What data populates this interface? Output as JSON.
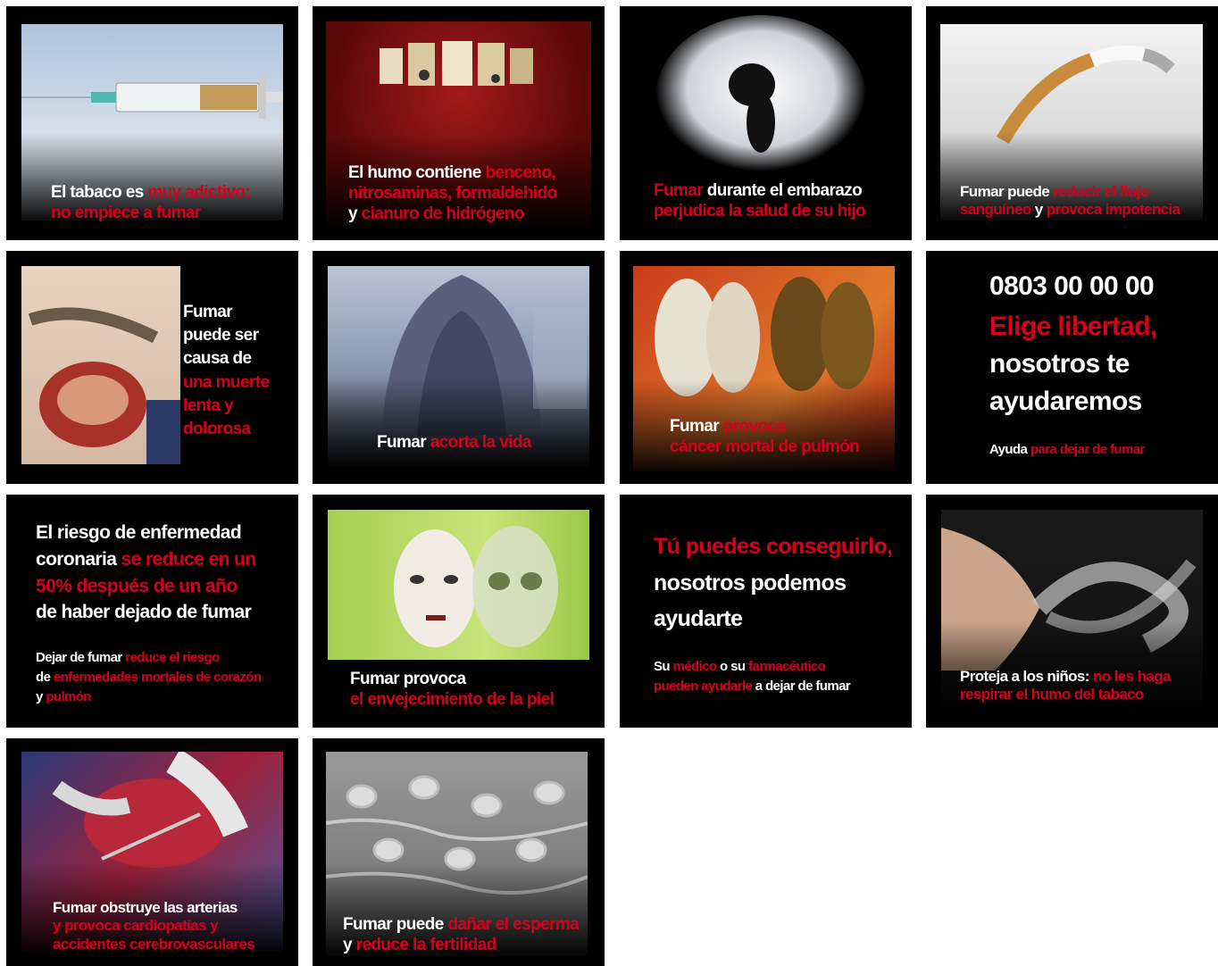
{
  "cards": [
    {
      "parts": [
        [
          "El tabaco es ",
          ""
        ],
        [
          "muy adictivo:",
          "red"
        ],
        [
          "\n",
          ""
        ],
        [
          "no empiece a fumar",
          "red"
        ]
      ]
    },
    {
      "parts": [
        [
          "El humo contiene ",
          ""
        ],
        [
          "benceno,",
          "red"
        ],
        [
          "\n",
          ""
        ],
        [
          "nitrosaminas, formaldehido",
          "red"
        ],
        [
          "\n",
          ""
        ],
        [
          "y ",
          ""
        ],
        [
          "cianuro de hidrógeno",
          "red"
        ]
      ]
    },
    {
      "parts": [
        [
          "Fumar",
          "red"
        ],
        [
          " durante el embarazo",
          ""
        ],
        [
          "\n",
          ""
        ],
        [
          "perjudica la salud de su hijo",
          "red"
        ]
      ]
    },
    {
      "parts": [
        [
          "Fumar puede ",
          ""
        ],
        [
          "reducir el flujo",
          "red"
        ],
        [
          "\n",
          ""
        ],
        [
          "sanguíneo",
          "red"
        ],
        [
          " y ",
          ""
        ],
        [
          "provoca impotencia",
          "red"
        ]
      ]
    },
    {
      "parts": [
        [
          "Fumar",
          ""
        ],
        [
          "\n",
          ""
        ],
        [
          "puede ser",
          ""
        ],
        [
          "\n",
          ""
        ],
        [
          "causa de",
          ""
        ],
        [
          "\n",
          ""
        ],
        [
          "una muerte",
          "red"
        ],
        [
          "\n",
          ""
        ],
        [
          "lenta y",
          "red"
        ],
        [
          "\n",
          ""
        ],
        [
          "dolorosa",
          "red"
        ]
      ]
    },
    {
      "parts": [
        [
          "Fumar ",
          ""
        ],
        [
          "acorta la vida",
          "red"
        ]
      ]
    },
    {
      "parts": [
        [
          "Fumar ",
          ""
        ],
        [
          "provoca",
          "red"
        ],
        [
          "\n",
          ""
        ],
        [
          "cáncer mortal de pulmón",
          "red"
        ]
      ]
    },
    {
      "parts": [
        [
          "0803 00 00 00",
          ""
        ]
      ],
      "slogan": [
        [
          "Elige libertad,",
          "red"
        ],
        [
          "\n",
          ""
        ],
        [
          "nosotros te",
          ""
        ],
        [
          "\n",
          ""
        ],
        [
          "ayudaremos",
          ""
        ]
      ],
      "foot": [
        [
          "Ayuda ",
          ""
        ],
        [
          "para dejar de fumar",
          "red"
        ]
      ]
    },
    {
      "parts": [
        [
          "El riesgo de enfermedad",
          ""
        ],
        [
          "\n",
          ""
        ],
        [
          "coronaria ",
          ""
        ],
        [
          "se reduce en un",
          "red"
        ],
        [
          "\n",
          ""
        ],
        [
          "50% después de un año",
          "red"
        ],
        [
          "\n",
          ""
        ],
        [
          "de haber dejado de fumar",
          ""
        ]
      ],
      "foot": [
        [
          "Dejar de fumar ",
          ""
        ],
        [
          "reduce el riesgo",
          "red"
        ],
        [
          "\n",
          ""
        ],
        [
          "de ",
          ""
        ],
        [
          "enfermedades mortales de corazón",
          "red"
        ],
        [
          "\n",
          ""
        ],
        [
          "y ",
          ""
        ],
        [
          "pulmón",
          "red"
        ]
      ]
    },
    {
      "parts": [
        [
          "Fumar provoca",
          ""
        ],
        [
          "\n",
          ""
        ],
        [
          "el envejecimiento de la piel",
          "red"
        ]
      ]
    },
    {
      "parts": [
        [
          "Tú puedes conseguirlo,",
          "red"
        ],
        [
          "\n",
          ""
        ],
        [
          "nosotros podemos",
          ""
        ],
        [
          "\n",
          ""
        ],
        [
          "ayudarte",
          ""
        ]
      ],
      "foot": [
        [
          "Su ",
          ""
        ],
        [
          "médico",
          "red"
        ],
        [
          " o su ",
          ""
        ],
        [
          "farmacéutico",
          "red"
        ],
        [
          "\n",
          ""
        ],
        [
          "pueden ayudarle",
          "red"
        ],
        [
          " a dejar de fumar",
          ""
        ]
      ]
    },
    {
      "parts": [
        [
          "Proteja a los niños: ",
          ""
        ],
        [
          "no les haga",
          "red"
        ],
        [
          "\n",
          ""
        ],
        [
          "respirar el humo del tabaco",
          "red"
        ]
      ]
    },
    {
      "parts": [
        [
          "Fumar obstruye las arterias",
          ""
        ],
        [
          "\n",
          ""
        ],
        [
          "y provoca cardiopatías y",
          "red"
        ],
        [
          "\n",
          ""
        ],
        [
          "accidentes cerebrovasculares",
          "red"
        ]
      ]
    },
    {
      "parts": [
        [
          "Fumar puede ",
          ""
        ],
        [
          "dañar el esperma",
          "red"
        ],
        [
          "\n",
          ""
        ],
        [
          "y ",
          ""
        ],
        [
          "reduce la fertilidad",
          "red"
        ]
      ]
    }
  ]
}
